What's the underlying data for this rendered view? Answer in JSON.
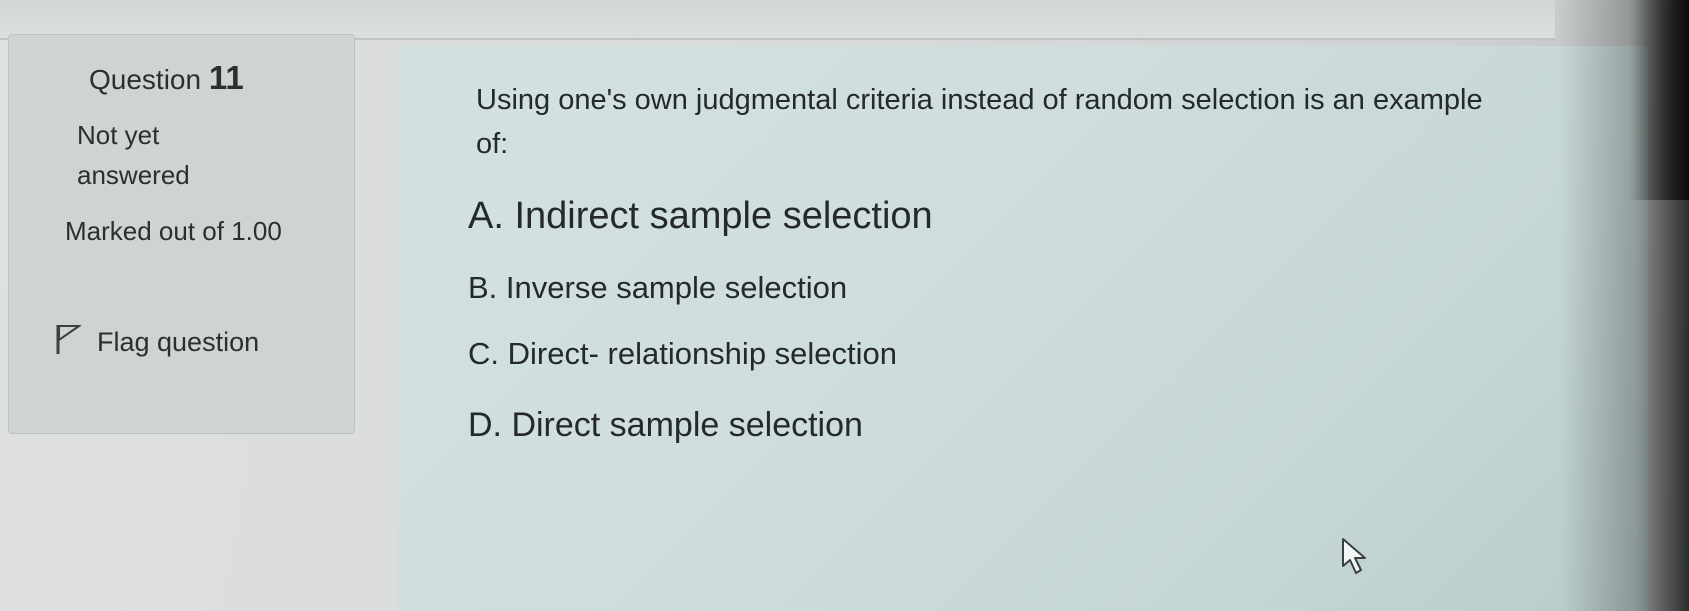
{
  "question_info": {
    "label": "Question",
    "number": "11",
    "status": "Not yet answered",
    "marked_out_of": "Marked out of 1.00",
    "flag_label": "Flag question"
  },
  "question": {
    "text": "Using one's own judgmental criteria instead of random selection is an example of:",
    "answers": [
      {
        "letter": "A.",
        "text": "Indirect sample selection"
      },
      {
        "letter": "B.",
        "text": "Inverse sample selection"
      },
      {
        "letter": "C.",
        "text": "Direct- relationship selection"
      },
      {
        "letter": "D.",
        "text": "Direct sample selection"
      }
    ]
  },
  "icons": {
    "flag": "flag-icon",
    "cursor": "mouse-pointer-icon"
  }
}
